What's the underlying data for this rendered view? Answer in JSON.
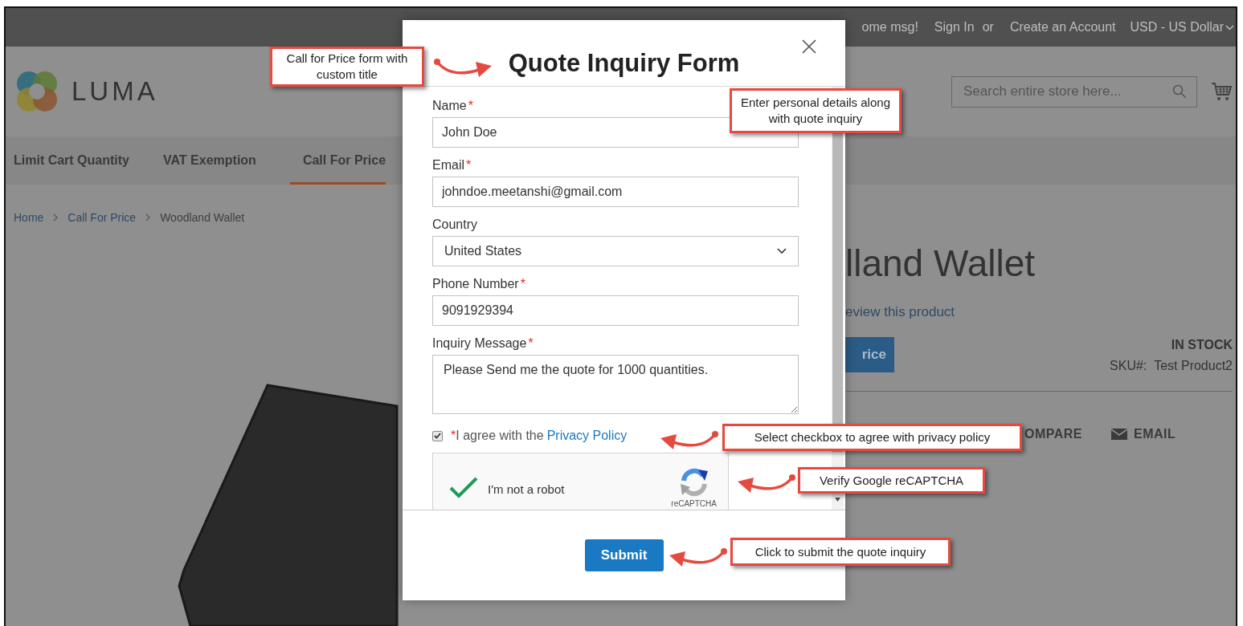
{
  "top_bar": {
    "welcome": "ome msg!",
    "sign_in": "Sign In",
    "separator": "or",
    "create_account": "Create an Account",
    "currency": "USD - US Dollar"
  },
  "header": {
    "logo": "LUMA",
    "search": {
      "placeholder": "Search entire store here..."
    }
  },
  "nav": [
    {
      "label": "Limit Cart Quantity",
      "selected": false
    },
    {
      "label": "VAT Exemption",
      "selected": false
    },
    {
      "label": "Call For Price",
      "selected": true
    }
  ],
  "breadcrumbs": [
    "Home",
    "Call For Price",
    "Woodland Wallet"
  ],
  "product": {
    "title": "lland Wallet",
    "review_link": "eview this product",
    "button": "rice",
    "stock": "IN STOCK",
    "sku_label": "SKU#:",
    "sku": "Test Product2",
    "actions": [
      {
        "label": "OMPARE",
        "kind": "plain"
      },
      {
        "label": "EMAIL",
        "kind": "email"
      }
    ]
  },
  "modal": {
    "title": "Quote Inquiry Form",
    "fields": [
      {
        "label": "Name",
        "required_mark": "*",
        "kind": "text",
        "value": "John Doe"
      },
      {
        "label": "Email",
        "required_mark": "*",
        "kind": "text",
        "value": "johndoe.meetanshi@gmail.com"
      },
      {
        "label": "Country",
        "kind": "select",
        "value": "United States"
      },
      {
        "label": "Phone Number",
        "required_mark": "*",
        "kind": "text",
        "value": "9091929394"
      },
      {
        "label": "Inquiry Message",
        "required_mark": "*",
        "kind": "textarea",
        "value": "Please Send me the quote for 1000 quantities."
      }
    ],
    "agree": {
      "checked": true,
      "required_mark": "*",
      "text": "I agree with the",
      "link": "Privacy Policy"
    },
    "captcha": {
      "checked": true,
      "label": "I'm not a robot",
      "brand": "reCAPTCHA"
    },
    "submit": "Submit"
  },
  "annotations": [
    {
      "text": "Call for Price form with custom title",
      "kind": "rightarrow"
    },
    {
      "text": "Enter personal details along with quote inquiry",
      "kind": "plain"
    },
    {
      "text": "Select checkbox to agree with privacy policy",
      "kind": "leftarrow"
    },
    {
      "text": "Verify Google reCAPTCHA",
      "kind": "leftarrow"
    },
    {
      "text": "Click to submit the quote inquiry",
      "kind": "leftarrow"
    }
  ]
}
